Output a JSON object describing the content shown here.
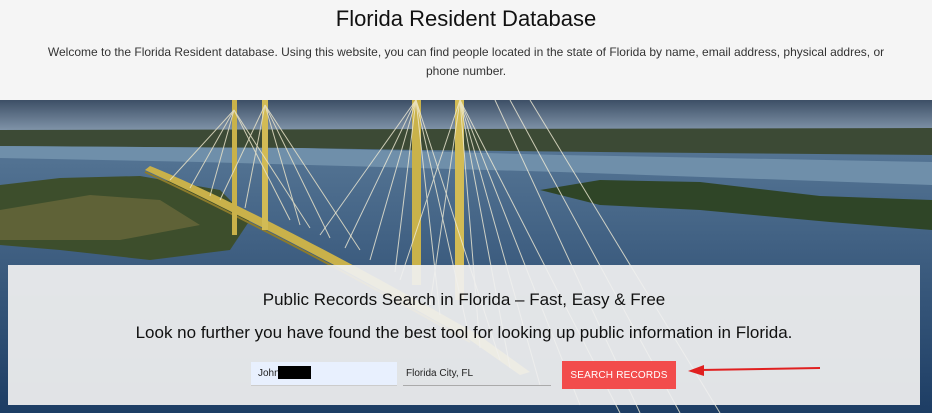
{
  "header": {
    "title": "Florida Resident Database",
    "description": "Welcome to the Florida Resident database. Using this website, you can find people located in the state of Florida by name, email address, physical addres, or phone number."
  },
  "search": {
    "heading": "Public Records Search in Florida – Fast, Easy & Free",
    "tagline": "Look no further you have found the best tool for looking up public information in Florida.",
    "name_value": "John",
    "location_value": "Florida City, FL",
    "button_label": "SEARCH RECORDS"
  },
  "colors": {
    "button": "#f24c4c",
    "arrow": "#e02020",
    "name_field_bg": "#e8f0fe"
  }
}
